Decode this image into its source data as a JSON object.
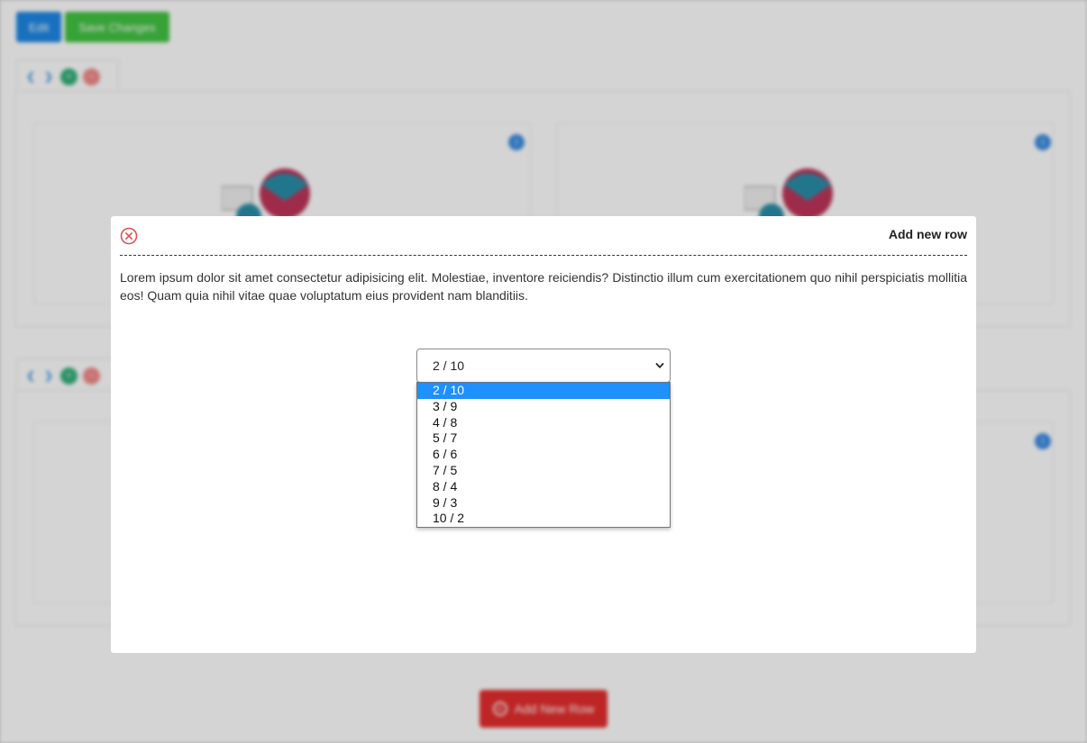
{
  "toolbar": {
    "edit_label": "Edit",
    "save_label": "Save Changes"
  },
  "add_row_button": {
    "label": "Add New Row"
  },
  "modal": {
    "title": "Add new row",
    "description": "Lorem ipsum dolor sit amet consectetur adipisicing elit. Molestiae, inventore reiciendis? Distinctio illum cum exercitationem quo nihil perspiciatis mollitia eos! Quam quia nihil vitae quae voluptatum eius provident nam blanditiis.",
    "select": {
      "selected": "2 / 10",
      "options": [
        "2 / 10",
        "3 / 9",
        "4 / 8",
        "5 / 7",
        "6 / 6",
        "7 / 5",
        "8 / 4",
        "9 / 3",
        "10 / 2"
      ]
    }
  },
  "colors": {
    "primary": "#1e88e5",
    "success": "#43c443",
    "danger": "#e52d2d",
    "close_icon": "#e05050",
    "option_highlight": "#1e90ff"
  }
}
